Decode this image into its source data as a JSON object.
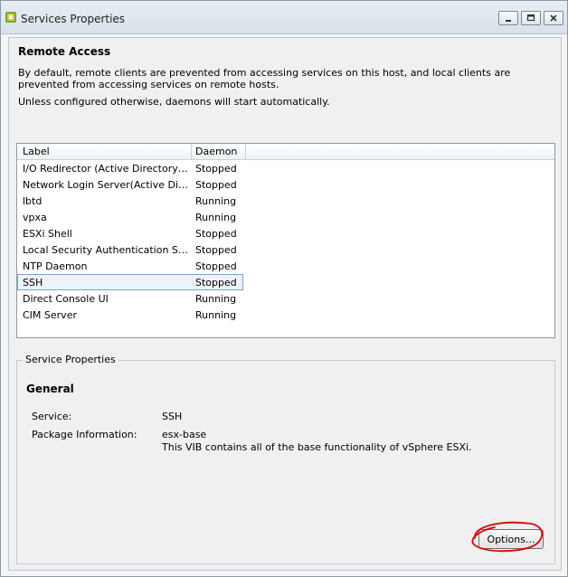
{
  "window": {
    "title": "Services Properties"
  },
  "remote_access": {
    "heading": "Remote Access",
    "description": "By default, remote clients are prevented from accessing services on this host, and local clients are prevented from accessing services on remote hosts.",
    "note": "Unless configured otherwise, daemons will start automatically."
  },
  "services_table": {
    "columns": [
      "Label",
      "Daemon"
    ],
    "rows": [
      {
        "label": "I/O Redirector (Active Directory Se...",
        "daemon": "Stopped"
      },
      {
        "label": "Network Login Server(Active Direc...",
        "daemon": "Stopped"
      },
      {
        "label": "lbtd",
        "daemon": "Running"
      },
      {
        "label": "vpxa",
        "daemon": "Running"
      },
      {
        "label": "ESXi Shell",
        "daemon": "Stopped"
      },
      {
        "label": "Local Security Authentication Serv...",
        "daemon": "Stopped"
      },
      {
        "label": "NTP Daemon",
        "daemon": "Stopped"
      },
      {
        "label": "SSH",
        "daemon": "Stopped"
      },
      {
        "label": "Direct Console UI",
        "daemon": "Running"
      },
      {
        "label": "CIM Server",
        "daemon": "Running"
      }
    ],
    "selected_row": 7
  },
  "service_properties": {
    "legend": "Service Properties",
    "general_heading": "General",
    "service_label": "Service:",
    "service_value": "SSH",
    "package_label": "Package Information:",
    "package_name": "esx-base",
    "package_description": "This VIB contains all of the base functionality of vSphere ESXi.",
    "options_button": "Options..."
  },
  "colors": {
    "selection_border": "#7da2ce",
    "annotation_circle": "#e00000"
  }
}
